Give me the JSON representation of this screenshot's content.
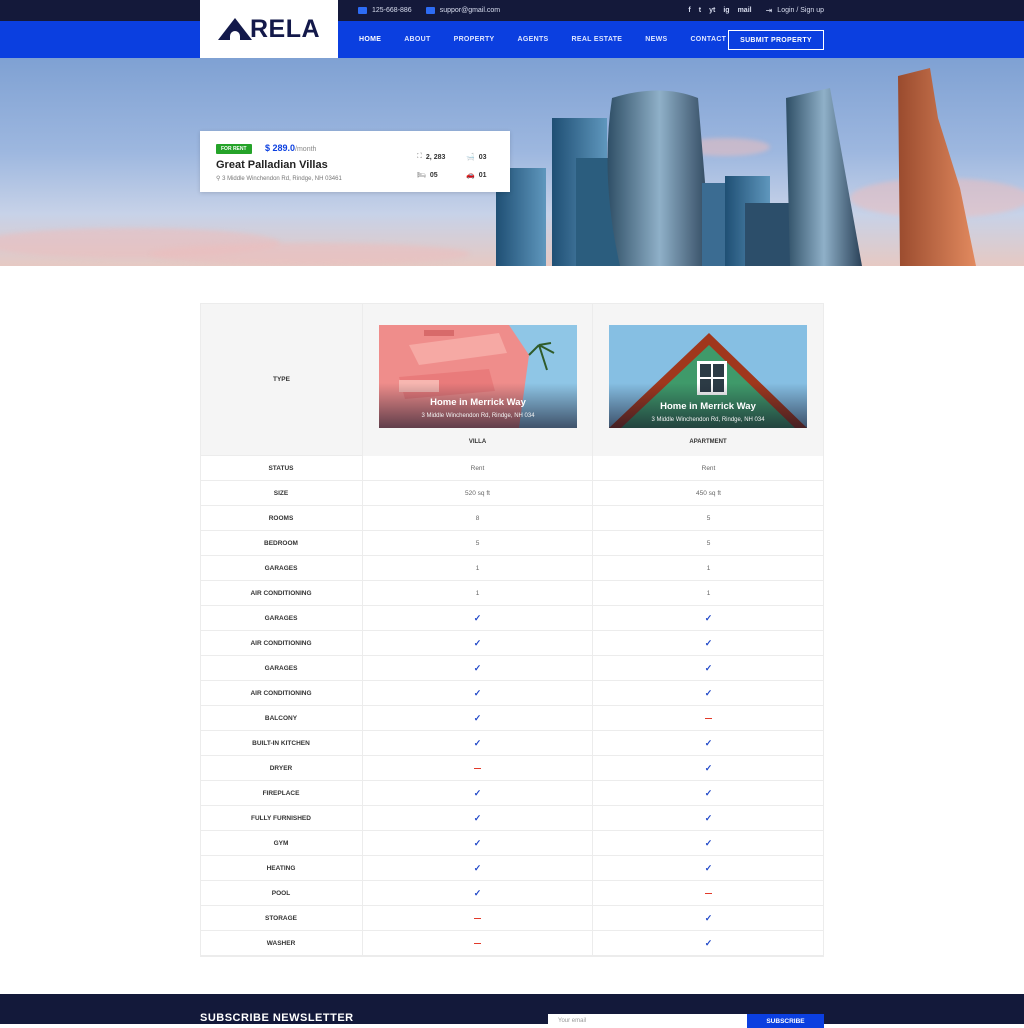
{
  "topbar": {
    "phone": "125-668-886",
    "email": "suppor@gmail.com",
    "socials": [
      "f",
      "t",
      "yt",
      "ig",
      "mail"
    ],
    "login": "Login / Sign up"
  },
  "nav": {
    "logo_text": "RELA",
    "items": [
      "HOME",
      "ABOUT",
      "PROPERTY",
      "AGENTS",
      "REAL ESTATE",
      "NEWS",
      "CONTACT"
    ],
    "active": "HOME",
    "submit_label": "SUBMIT PROPERTY"
  },
  "listing": {
    "badge": "FOR RENT",
    "price": "$ 289.0",
    "period": "/month",
    "title": "Great Palladian Villas",
    "address": "3 Middle Winchendon Rd, Rindge, NH 03461",
    "area": "2, 283",
    "baths": "03",
    "beds": "05",
    "garages": "01"
  },
  "compare": {
    "type_label": "TYPE",
    "properties": [
      {
        "title": "Home in Merrick Way",
        "address": "3 Middle Winchendon Rd, Rindge, NH 034",
        "type": "VILLA"
      },
      {
        "title": "Home in Merrick Way",
        "address": "3 Middle Winchendon Rd, Rindge, NH 034",
        "type": "APARTMENT"
      }
    ],
    "rows": [
      {
        "label": "STATUS",
        "a": "Rent",
        "b": "Rent"
      },
      {
        "label": "SIZE",
        "a": "520 sq ft",
        "b": "450 sq ft"
      },
      {
        "label": "ROOMS",
        "a": "8",
        "b": "5"
      },
      {
        "label": "BEDROOM",
        "a": "5",
        "b": "5"
      },
      {
        "label": "GARAGES",
        "a": "1",
        "b": "1"
      },
      {
        "label": "AIR CONDITIONING",
        "a": "1",
        "b": "1"
      },
      {
        "label": "GARAGES",
        "a": "yes",
        "b": "yes"
      },
      {
        "label": "AIR CONDITIONING",
        "a": "yes",
        "b": "yes"
      },
      {
        "label": "GARAGES",
        "a": "yes",
        "b": "yes"
      },
      {
        "label": "AIR CONDITIONING",
        "a": "yes",
        "b": "yes"
      },
      {
        "label": "BALCONY",
        "a": "yes",
        "b": "no"
      },
      {
        "label": "BUILT-IN KITCHEN",
        "a": "yes",
        "b": "yes"
      },
      {
        "label": "DRYER",
        "a": "no",
        "b": "yes"
      },
      {
        "label": "FIREPLACE",
        "a": "yes",
        "b": "yes"
      },
      {
        "label": "FULLY FURNISHED",
        "a": "yes",
        "b": "yes"
      },
      {
        "label": "GYM",
        "a": "yes",
        "b": "yes"
      },
      {
        "label": "HEATING",
        "a": "yes",
        "b": "yes"
      },
      {
        "label": "POOL",
        "a": "yes",
        "b": "no"
      },
      {
        "label": "STORAGE",
        "a": "no",
        "b": "yes"
      },
      {
        "label": "WASHER",
        "a": "no",
        "b": "yes"
      }
    ]
  },
  "footer": {
    "newsletter_title": "SUBSCRIBE NEWSLETTER",
    "email_placeholder": "Your email",
    "subscribe_label": "SUBSCRIBE"
  },
  "colors": {
    "primary": "#0b3fe0",
    "dark": "#13193a",
    "badge": "#25a329",
    "check": "#1f47c8",
    "cross": "#e23a2a"
  }
}
